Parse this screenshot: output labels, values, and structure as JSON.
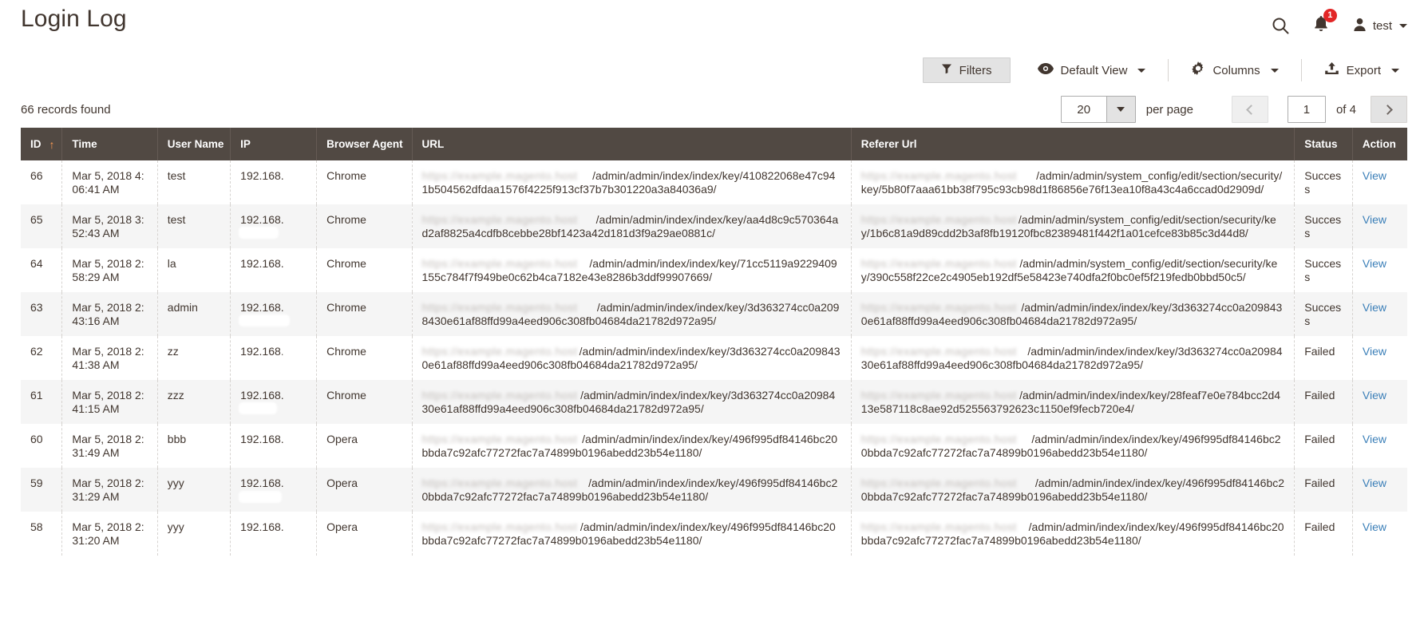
{
  "header": {
    "title": "Login Log",
    "search_icon": "search-icon",
    "notifications_icon": "bell-icon",
    "notifications_count": "1",
    "user_icon": "user-avatar-icon",
    "user_name": "test"
  },
  "toolbar": {
    "filters_label": "Filters",
    "filters_icon": "funnel-icon",
    "view_label": "Default View",
    "view_icon": "eye-icon",
    "columns_label": "Columns",
    "columns_icon": "gear-icon",
    "export_label": "Export",
    "export_icon": "upload-icon"
  },
  "records": {
    "found_text": "66 records found",
    "per_page_value": "20",
    "per_page_label": "per page",
    "current_page": "1",
    "of_total": "of 4"
  },
  "table": {
    "columns": [
      {
        "key": "id",
        "label": "ID",
        "sort": "↑"
      },
      {
        "key": "time",
        "label": "Time"
      },
      {
        "key": "user",
        "label": "User Name"
      },
      {
        "key": "ip",
        "label": "IP"
      },
      {
        "key": "agent",
        "label": "Browser Agent"
      },
      {
        "key": "url",
        "label": "URL"
      },
      {
        "key": "referer",
        "label": "Referer Url"
      },
      {
        "key": "status",
        "label": "Status"
      },
      {
        "key": "action",
        "label": "Action"
      }
    ],
    "rows": [
      {
        "id": "66",
        "time": "Mar 5, 2018 4:06:41 AM",
        "user": "test",
        "ip": "192.168.",
        "agent": "Chrome",
        "url": "/admin/admin/index/index/key/410822068e47c941b504562dfdaa1576f4225f913cf37b7b301220a3a84036a9/",
        "referer": "/admin/admin/system_config/edit/section/security/key/5b80f7aaa61bb38f795c93cb98d1f86856e76f13ea10f8a43c4a6ccad0d2909d/",
        "status": "Success",
        "action": "View"
      },
      {
        "id": "65",
        "time": "Mar 5, 2018 3:52:43 AM",
        "user": "test",
        "ip": "192.168.",
        "agent": "Chrome",
        "url": "/admin/admin/index/index/key/aa4d8c9c570364ad2af8825a4cdfb8cebbe28bf1423a42d181d3f9a29ae0881c/",
        "referer": "/admin/admin/system_config/edit/section/security/key/1b6c81a9d89cdd2b3af8fb19120fbc82389481f442f1a01cefce83b85c3d44d8/",
        "status": "Success",
        "action": "View"
      },
      {
        "id": "64",
        "time": "Mar 5, 2018 2:58:29 AM",
        "user": "la",
        "ip": "192.168.",
        "agent": "Chrome",
        "url": "/admin/admin/index/index/key/71cc5119a9229409155c784f7f949be0c62b4ca7182e43e8286b3ddf99907669/",
        "referer": "/admin/admin/system_config/edit/section/security/key/390c558f22ce2c4905eb192df5e58423e740dfa2f0bc0ef5f219fedb0bbd50c5/",
        "status": "Success",
        "action": "View"
      },
      {
        "id": "63",
        "time": "Mar 5, 2018 2:43:16 AM",
        "user": "admin",
        "ip": "192.168.",
        "agent": "Chrome",
        "url": "/admin/admin/index/index/key/3d363274cc0a2098430e61af88ffd99a4eed906c308fb04684da21782d972a95/",
        "referer": "/admin/admin/index/index/key/3d363274cc0a2098430e61af88ffd99a4eed906c308fb04684da21782d972a95/",
        "status": "Success",
        "action": "View"
      },
      {
        "id": "62",
        "time": "Mar 5, 2018 2:41:38 AM",
        "user": "zz",
        "ip": "192.168.",
        "agent": "Chrome",
        "url": "/admin/admin/index/index/key/3d363274cc0a2098430e61af88ffd99a4eed906c308fb04684da21782d972a95/",
        "referer": "/admin/admin/index/index/key/3d363274cc0a2098430e61af88ffd99a4eed906c308fb04684da21782d972a95/",
        "status": "Failed",
        "action": "View"
      },
      {
        "id": "61",
        "time": "Mar 5, 2018 2:41:15 AM",
        "user": "zzz",
        "ip": "192.168.",
        "agent": "Chrome",
        "url": "/admin/admin/index/index/key/3d363274cc0a2098430e61af88ffd99a4eed906c308fb04684da21782d972a95/",
        "referer": "/admin/admin/index/index/key/28feaf7e0e784bcc2d413e587118c8ae92d525563792623c1150ef9fecb720e4/",
        "status": "Failed",
        "action": "View"
      },
      {
        "id": "60",
        "time": "Mar 5, 2018 2:31:49 AM",
        "user": "bbb",
        "ip": "192.168.",
        "agent": "Opera",
        "url": "/admin/admin/index/index/key/496f995df84146bc20bbda7c92afc77272fac7a74899b0196abedd23b54e1180/",
        "referer": "/admin/admin/index/index/key/496f995df84146bc20bbda7c92afc77272fac7a74899b0196abedd23b54e1180/",
        "status": "Failed",
        "action": "View"
      },
      {
        "id": "59",
        "time": "Mar 5, 2018 2:31:29 AM",
        "user": "yyy",
        "ip": "192.168.",
        "agent": "Opera",
        "url": "/admin/admin/index/index/key/496f995df84146bc20bbda7c92afc77272fac7a74899b0196abedd23b54e1180/",
        "referer": "/admin/admin/index/index/key/496f995df84146bc20bbda7c92afc77272fac7a74899b0196abedd23b54e1180/",
        "status": "Failed",
        "action": "View"
      },
      {
        "id": "58",
        "time": "Mar 5, 2018 2:31:20 AM",
        "user": "yyy",
        "ip": "192.168.",
        "agent": "Opera",
        "url": "/admin/admin/index/index/key/496f995df84146bc20bbda7c92afc77272fac7a74899b0196abedd23b54e1180/",
        "referer": "/admin/admin/index/index/key/496f995df84146bc20bbda7c92afc77272fac7a74899b0196abedd23b54e1180/",
        "status": "Failed",
        "action": "View"
      }
    ]
  },
  "colors": {
    "header_bar": "#514943",
    "success": "#458a45",
    "failed": "#e9504a",
    "link": "#3b7fb8",
    "badge": "#e22626",
    "sort_arrow": "#ff9d52"
  }
}
